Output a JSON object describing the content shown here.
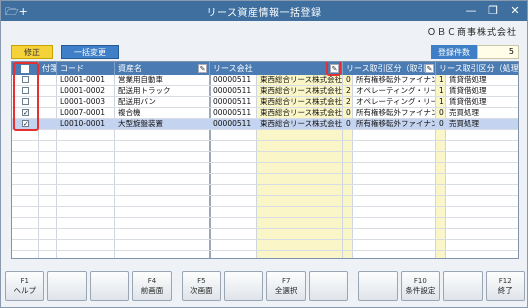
{
  "window": {
    "title": "リース資産情報一括登録",
    "app_icon": "folder-plus-icon",
    "company": "ＯＢＣ商事株式会社"
  },
  "toolbar": {
    "modify_label": "修正",
    "bulk_change_label": "一括変更",
    "count_label": "登録件数",
    "count_value": "5"
  },
  "grid": {
    "headers": {
      "check": "",
      "kubun": "付箋",
      "code": "コード",
      "asset_name": "資産名",
      "lease_company": "リース会社",
      "lease_type": "リース取引区分（取引）",
      "lease_type2": "リース取引区分（処理方"
    },
    "rows": [
      {
        "checked": false,
        "code": "L0001-0001",
        "name": "営業用自動車",
        "company_code": "00000511",
        "company_name": "東西総合リース株式会社",
        "n1": "0",
        "type": "所有権移転外ファイナン",
        "n2": "1",
        "proc": "賃貸借処理",
        "selected": false
      },
      {
        "checked": false,
        "code": "L0001-0002",
        "name": "配送用トラック",
        "company_code": "00000511",
        "company_name": "東西総合リース株式会社",
        "n1": "2",
        "type": "オペレーティング・リー",
        "n2": "1",
        "proc": "賃貸借処理",
        "selected": false
      },
      {
        "checked": false,
        "code": "L0001-0003",
        "name": "配送用バン",
        "company_code": "00000511",
        "company_name": "東西総合リース株式会社",
        "n1": "2",
        "type": "オペレーティング・リー",
        "n2": "1",
        "proc": "賃貸借処理",
        "selected": false
      },
      {
        "checked": true,
        "code": "L0007-0001",
        "name": "複合機",
        "company_code": "00000511",
        "company_name": "東西総合リース株式会社",
        "n1": "0",
        "type": "所有権移転外ファイナン",
        "n2": "0",
        "proc": "売買処理",
        "selected": false
      },
      {
        "checked": true,
        "code": "L0010-0001",
        "name": "大型旋盤装置",
        "company_code": "00000511",
        "company_name": "東西総合リース株式会社",
        "n1": "0",
        "type": "所有権移転外ファイナン",
        "n2": "0",
        "proc": "売買処理",
        "selected": true
      }
    ]
  },
  "fkeys": [
    {
      "key": "F1",
      "label": "ヘルプ"
    },
    {
      "key": "",
      "label": ""
    },
    {
      "key": "",
      "label": ""
    },
    {
      "key": "F4",
      "label": "前画面"
    },
    {
      "key": "F5",
      "label": "次画面"
    },
    {
      "key": "",
      "label": ""
    },
    {
      "key": "F7",
      "label": "全選択"
    },
    {
      "key": "",
      "label": ""
    },
    {
      "key": "",
      "label": ""
    },
    {
      "key": "F10",
      "label": "条件設定"
    },
    {
      "key": "",
      "label": ""
    },
    {
      "key": "F12",
      "label": "終了"
    }
  ]
}
